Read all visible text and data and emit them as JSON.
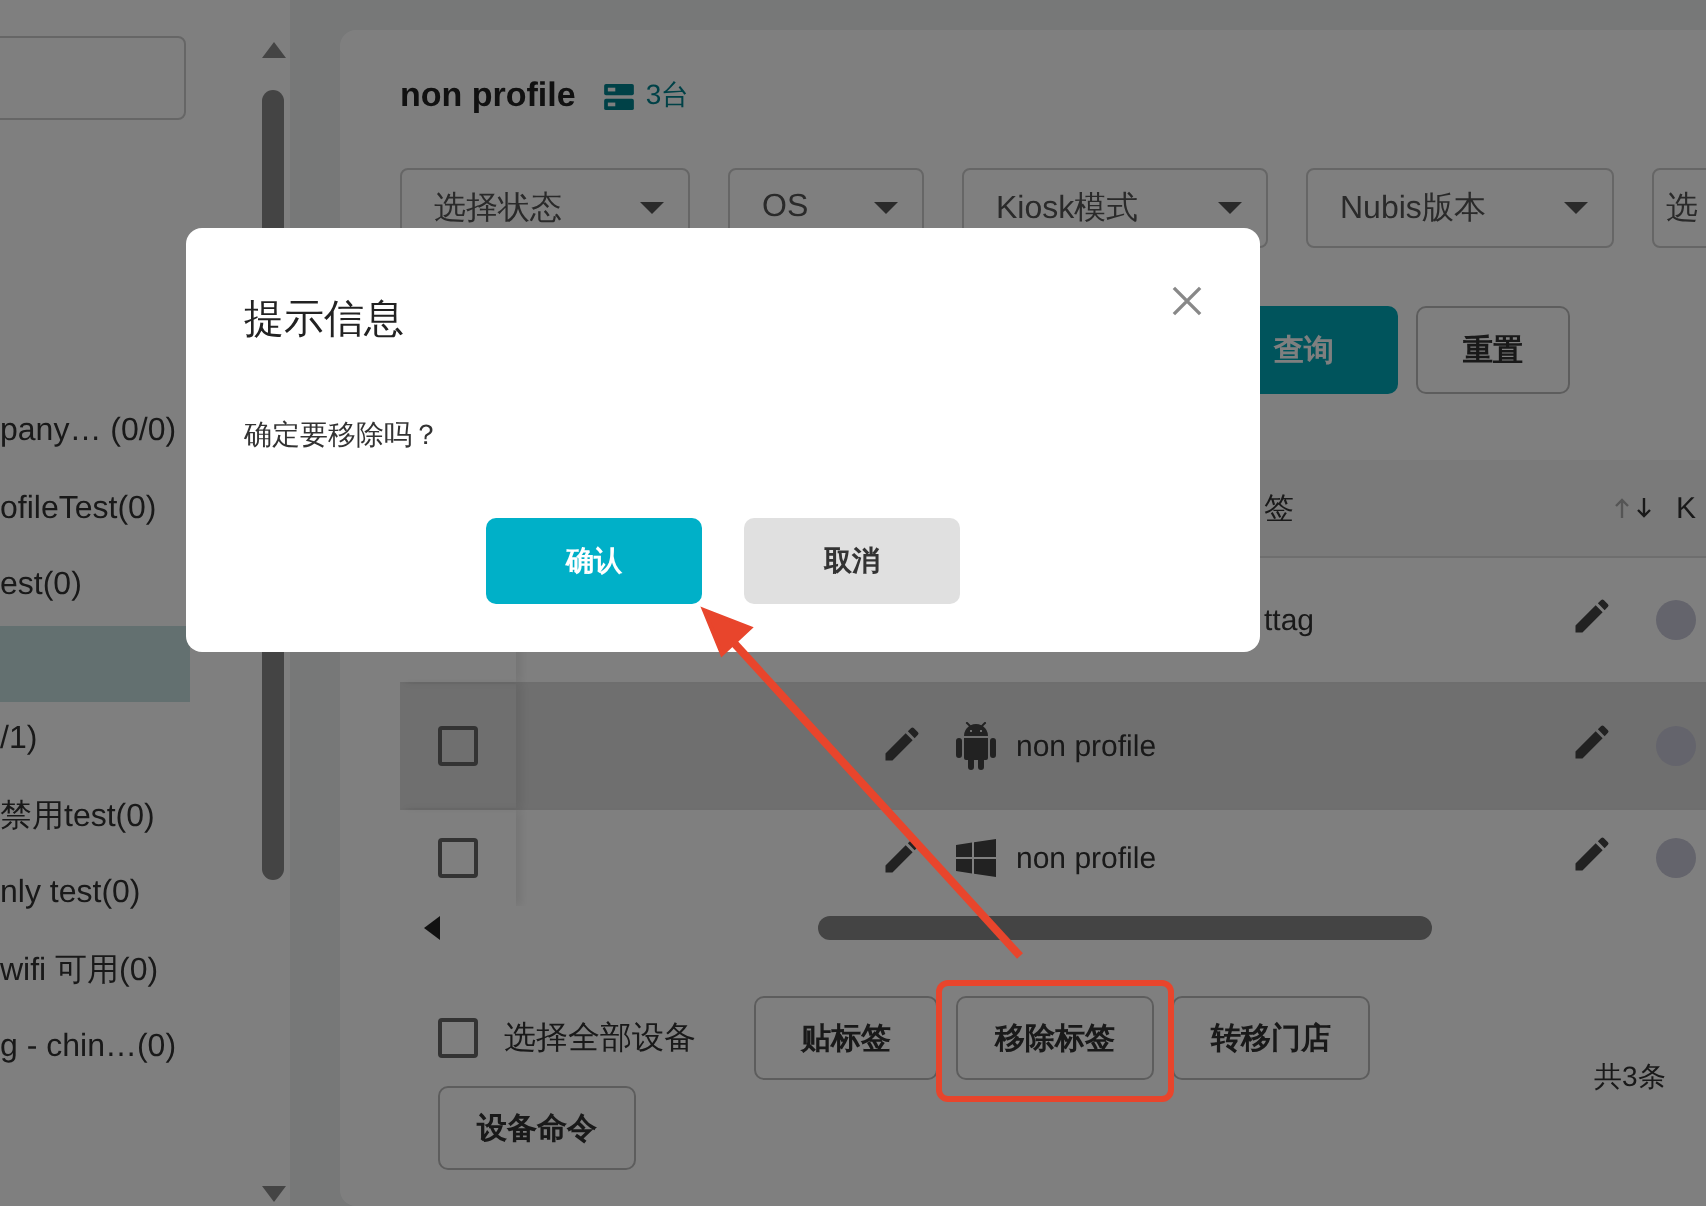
{
  "sidebar": {
    "items": [
      {
        "label": "pany… (0/0)",
        "selected": false
      },
      {
        "label": "ofileTest(0)",
        "selected": false
      },
      {
        "label": "est(0)",
        "selected": false
      },
      {
        "selected": true
      },
      {
        "label": "/1)",
        "selected": false
      },
      {
        "label": "禁用test(0)",
        "selected": false
      },
      {
        "label": "nly test(0)",
        "selected": false
      },
      {
        "label": "wifi 可用(0)",
        "selected": false
      },
      {
        "label": "g - chin…(0)",
        "selected": false
      }
    ]
  },
  "header": {
    "title": "non profile",
    "device_count": "3台"
  },
  "filters": [
    {
      "label": "选择状态"
    },
    {
      "label": "OS"
    },
    {
      "label": "Kiosk模式"
    },
    {
      "label": "Nubis版本"
    },
    {
      "label": "选"
    }
  ],
  "query_buttons": [
    {
      "label": "查询",
      "kind": "primary"
    },
    {
      "label": "重置",
      "kind": "secondary"
    }
  ],
  "table": {
    "columns": [
      {
        "label": "签",
        "sortable": true
      },
      {
        "label": "K"
      }
    ],
    "rows": [
      {
        "tag": "ttag",
        "hovered": false
      },
      {
        "kind": "android",
        "tag": "non profile",
        "checked": false,
        "hovered": true
      },
      {
        "kind": "windows",
        "tag": "non profile",
        "checked": false,
        "hovered": false
      }
    ]
  },
  "footer": {
    "select_all": {
      "label": "选择全部设备",
      "checked": false
    },
    "actions": [
      {
        "label": "贴标签",
        "highlighted": false
      },
      {
        "label": "移除标签",
        "highlighted": true
      },
      {
        "label": "转移门店",
        "highlighted": false
      },
      {
        "label": "设备命令",
        "highlighted": false
      }
    ],
    "total": "共3条"
  },
  "dialog": {
    "title": "提示信息",
    "message": "确定要移除吗？",
    "buttons": [
      {
        "label": "确认",
        "kind": "primary"
      },
      {
        "label": "取消",
        "kind": "secondary"
      }
    ]
  }
}
